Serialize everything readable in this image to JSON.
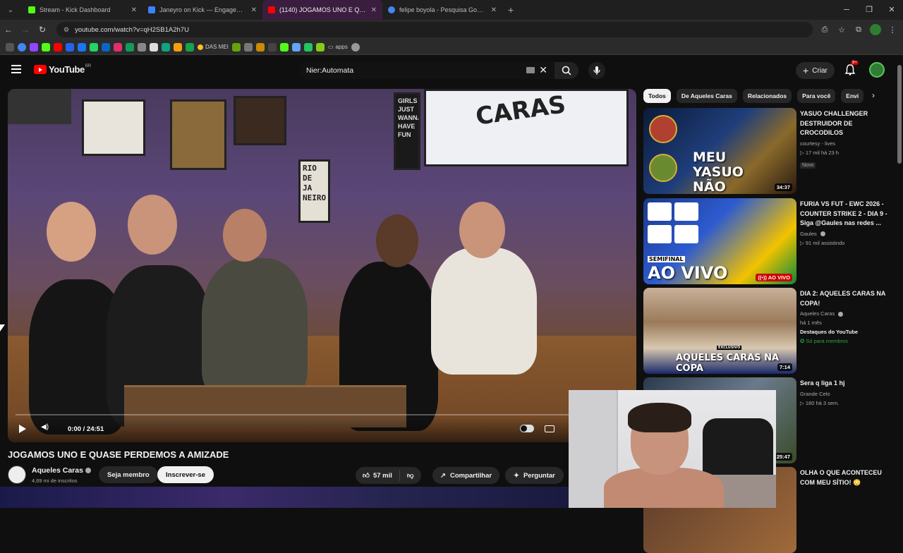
{
  "browser": {
    "tabs": [
      {
        "label": "Stream - Kick Dashboard",
        "color": "#53fc18",
        "active": false
      },
      {
        "label": "Janeyro on Kick — Engagement",
        "color": "#3b82f6",
        "active": false
      },
      {
        "label": "(1140) JOGAMOS UNO E QUASE",
        "color": "#ff0000",
        "active": true
      },
      {
        "label": "felipe boyola - Pesquisa Google",
        "color": "#4285f4",
        "active": false
      }
    ],
    "url": "youtube.com/watch?v=qH2SB1A2h7U",
    "bookmarks": {
      "das_mei": "DAS MEI",
      "apps": "apps"
    }
  },
  "youtube": {
    "logo_text": "YouTube",
    "region": "BR",
    "search_value": "Nier:Automata",
    "create_label": "Criar",
    "notif_badge": "9+"
  },
  "video": {
    "title": "JOGAMOS UNO E QUASE PERDEMOS A AMIZADE",
    "time": "0:00 / 24:51",
    "progress": 0.0,
    "channel": "Aqueles Caras",
    "subscribers": "4,69 mi de inscritos",
    "member_label": "Seja membro",
    "subscribe_label": "Inscrever-se",
    "likes": "57 mil",
    "share_label": "Compartilhar",
    "ask_label": "Perguntar",
    "scene_text": {
      "rio": "RIO DE JA NEIRO",
      "wanna": "GIRLS JUST WANNA HAVE FUN",
      "tv": "CARAS"
    }
  },
  "chips": [
    "Todos",
    "De Aqueles Caras",
    "Relacionados",
    "Para você",
    "Envi"
  ],
  "related": [
    {
      "title": "YASUO CHALLENGER DESTRUIDOR DE CROCODILOS",
      "channel": "courtesy - lives",
      "meta": "▷ 17 mil  há 23 h",
      "badge": "Novo",
      "duration": "34:37",
      "thumb_text": "MEU YASUO NÃO PERDE"
    },
    {
      "title": "FURIA VS FUT - EWC 2026 - COUNTER STRIKE 2 - DIA 9 - Siga @Gaules nas redes ...",
      "channel": "Gaules",
      "meta": "▷ 91 mil assistindo",
      "duration": "AO VIVO",
      "thumb_text": "AO VIVO",
      "thumb_sub": "SEMIFINAL"
    },
    {
      "title": "DIA 2: AQUELES CARAS NA COPA!",
      "channel": "Aqueles Caras",
      "meta": "há 1 mês",
      "highlight": "Destaques do YouTube",
      "members": "Só para membros",
      "duration": "7:14",
      "thumb_text": "AQUELES CARAS NA COPA",
      "thumb_sub": "EXCLUSIVO"
    },
    {
      "title": "Sera q liga 1 hj",
      "channel": "Grande Celo",
      "meta": "▷ 180  há 3 sem.",
      "duration": "25:47"
    },
    {
      "title": "OLHA O QUE ACONTECEU COM MEU SÍTIO! 😳",
      "channel": "",
      "meta": ""
    }
  ]
}
